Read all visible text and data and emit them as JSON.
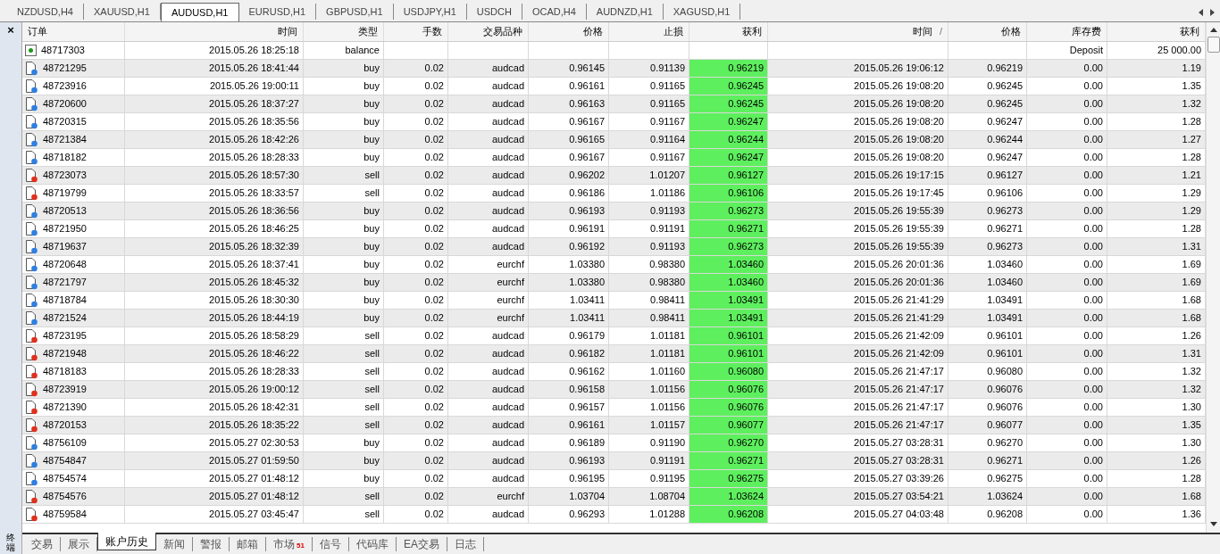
{
  "chart_tabs": [
    {
      "label": "NZDUSD,H4",
      "selected": false
    },
    {
      "label": "XAUUSD,H1",
      "selected": false
    },
    {
      "label": "AUDUSD,H1",
      "selected": true
    },
    {
      "label": "EURUSD,H1",
      "selected": false
    },
    {
      "label": "GBPUSD,H1",
      "selected": false
    },
    {
      "label": "USDJPY,H1",
      "selected": false
    },
    {
      "label": "USDCH",
      "selected": false
    },
    {
      "label": "OCAD,H4",
      "selected": false
    },
    {
      "label": "AUDNZD,H1",
      "selected": false
    },
    {
      "label": "XAGUSD,H1",
      "selected": false
    }
  ],
  "panel": {
    "close": "×",
    "title": "终端"
  },
  "table": {
    "columns": [
      {
        "label": "订单"
      },
      {
        "label": "时间"
      },
      {
        "label": "类型"
      },
      {
        "label": "手数"
      },
      {
        "label": "交易品种"
      },
      {
        "label": "价格"
      },
      {
        "label": "止损"
      },
      {
        "label": "获利"
      },
      {
        "label": "时间",
        "sort_mark": "/"
      },
      {
        "label": "价格"
      },
      {
        "label": "库存费"
      },
      {
        "label": "获利"
      }
    ],
    "rows": [
      {
        "kind": "balance",
        "order": "48717303",
        "open_time": "2015.05.26 18:25:18",
        "type": "balance",
        "swap": "Deposit",
        "profit": "25 000.00"
      },
      {
        "kind": "buy",
        "order": "48721295",
        "open_time": "2015.05.26 18:41:44",
        "type": "buy",
        "lots": "0.02",
        "symbol": "audcad",
        "open_price": "0.96145",
        "sl": "0.91139",
        "tp": "0.96219",
        "close_time": "2015.05.26 19:06:12",
        "close_price": "0.96219",
        "swap": "0.00",
        "profit": "1.19"
      },
      {
        "kind": "buy",
        "order": "48723916",
        "open_time": "2015.05.26 19:00:11",
        "type": "buy",
        "lots": "0.02",
        "symbol": "audcad",
        "open_price": "0.96161",
        "sl": "0.91165",
        "tp": "0.96245",
        "close_time": "2015.05.26 19:08:20",
        "close_price": "0.96245",
        "swap": "0.00",
        "profit": "1.35"
      },
      {
        "kind": "buy",
        "order": "48720600",
        "open_time": "2015.05.26 18:37:27",
        "type": "buy",
        "lots": "0.02",
        "symbol": "audcad",
        "open_price": "0.96163",
        "sl": "0.91165",
        "tp": "0.96245",
        "close_time": "2015.05.26 19:08:20",
        "close_price": "0.96245",
        "swap": "0.00",
        "profit": "1.32"
      },
      {
        "kind": "buy",
        "order": "48720315",
        "open_time": "2015.05.26 18:35:56",
        "type": "buy",
        "lots": "0.02",
        "symbol": "audcad",
        "open_price": "0.96167",
        "sl": "0.91167",
        "tp": "0.96247",
        "close_time": "2015.05.26 19:08:20",
        "close_price": "0.96247",
        "swap": "0.00",
        "profit": "1.28"
      },
      {
        "kind": "buy",
        "order": "48721384",
        "open_time": "2015.05.26 18:42:26",
        "type": "buy",
        "lots": "0.02",
        "symbol": "audcad",
        "open_price": "0.96165",
        "sl": "0.91164",
        "tp": "0.96244",
        "close_time": "2015.05.26 19:08:20",
        "close_price": "0.96244",
        "swap": "0.00",
        "profit": "1.27"
      },
      {
        "kind": "buy",
        "order": "48718182",
        "open_time": "2015.05.26 18:28:33",
        "type": "buy",
        "lots": "0.02",
        "symbol": "audcad",
        "open_price": "0.96167",
        "sl": "0.91167",
        "tp": "0.96247",
        "close_time": "2015.05.26 19:08:20",
        "close_price": "0.96247",
        "swap": "0.00",
        "profit": "1.28"
      },
      {
        "kind": "sell",
        "order": "48723073",
        "open_time": "2015.05.26 18:57:30",
        "type": "sell",
        "lots": "0.02",
        "symbol": "audcad",
        "open_price": "0.96202",
        "sl": "1.01207",
        "tp": "0.96127",
        "close_time": "2015.05.26 19:17:15",
        "close_price": "0.96127",
        "swap": "0.00",
        "profit": "1.21"
      },
      {
        "kind": "sell",
        "order": "48719799",
        "open_time": "2015.05.26 18:33:57",
        "type": "sell",
        "lots": "0.02",
        "symbol": "audcad",
        "open_price": "0.96186",
        "sl": "1.01186",
        "tp": "0.96106",
        "close_time": "2015.05.26 19:17:45",
        "close_price": "0.96106",
        "swap": "0.00",
        "profit": "1.29"
      },
      {
        "kind": "buy",
        "order": "48720513",
        "open_time": "2015.05.26 18:36:56",
        "type": "buy",
        "lots": "0.02",
        "symbol": "audcad",
        "open_price": "0.96193",
        "sl": "0.91193",
        "tp": "0.96273",
        "close_time": "2015.05.26 19:55:39",
        "close_price": "0.96273",
        "swap": "0.00",
        "profit": "1.29"
      },
      {
        "kind": "buy",
        "order": "48721950",
        "open_time": "2015.05.26 18:46:25",
        "type": "buy",
        "lots": "0.02",
        "symbol": "audcad",
        "open_price": "0.96191",
        "sl": "0.91191",
        "tp": "0.96271",
        "close_time": "2015.05.26 19:55:39",
        "close_price": "0.96271",
        "swap": "0.00",
        "profit": "1.28"
      },
      {
        "kind": "buy",
        "order": "48719637",
        "open_time": "2015.05.26 18:32:39",
        "type": "buy",
        "lots": "0.02",
        "symbol": "audcad",
        "open_price": "0.96192",
        "sl": "0.91193",
        "tp": "0.96273",
        "close_time": "2015.05.26 19:55:39",
        "close_price": "0.96273",
        "swap": "0.00",
        "profit": "1.31"
      },
      {
        "kind": "buy",
        "order": "48720648",
        "open_time": "2015.05.26 18:37:41",
        "type": "buy",
        "lots": "0.02",
        "symbol": "eurchf",
        "open_price": "1.03380",
        "sl": "0.98380",
        "tp": "1.03460",
        "close_time": "2015.05.26 20:01:36",
        "close_price": "1.03460",
        "swap": "0.00",
        "profit": "1.69"
      },
      {
        "kind": "buy",
        "order": "48721797",
        "open_time": "2015.05.26 18:45:32",
        "type": "buy",
        "lots": "0.02",
        "symbol": "eurchf",
        "open_price": "1.03380",
        "sl": "0.98380",
        "tp": "1.03460",
        "close_time": "2015.05.26 20:01:36",
        "close_price": "1.03460",
        "swap": "0.00",
        "profit": "1.69"
      },
      {
        "kind": "buy",
        "order": "48718784",
        "open_time": "2015.05.26 18:30:30",
        "type": "buy",
        "lots": "0.02",
        "symbol": "eurchf",
        "open_price": "1.03411",
        "sl": "0.98411",
        "tp": "1.03491",
        "close_time": "2015.05.26 21:41:29",
        "close_price": "1.03491",
        "swap": "0.00",
        "profit": "1.68"
      },
      {
        "kind": "buy",
        "order": "48721524",
        "open_time": "2015.05.26 18:44:19",
        "type": "buy",
        "lots": "0.02",
        "symbol": "eurchf",
        "open_price": "1.03411",
        "sl": "0.98411",
        "tp": "1.03491",
        "close_time": "2015.05.26 21:41:29",
        "close_price": "1.03491",
        "swap": "0.00",
        "profit": "1.68"
      },
      {
        "kind": "sell",
        "order": "48723195",
        "open_time": "2015.05.26 18:58:29",
        "type": "sell",
        "lots": "0.02",
        "symbol": "audcad",
        "open_price": "0.96179",
        "sl": "1.01181",
        "tp": "0.96101",
        "close_time": "2015.05.26 21:42:09",
        "close_price": "0.96101",
        "swap": "0.00",
        "profit": "1.26"
      },
      {
        "kind": "sell",
        "order": "48721948",
        "open_time": "2015.05.26 18:46:22",
        "type": "sell",
        "lots": "0.02",
        "symbol": "audcad",
        "open_price": "0.96182",
        "sl": "1.01181",
        "tp": "0.96101",
        "close_time": "2015.05.26 21:42:09",
        "close_price": "0.96101",
        "swap": "0.00",
        "profit": "1.31"
      },
      {
        "kind": "sell",
        "order": "48718183",
        "open_time": "2015.05.26 18:28:33",
        "type": "sell",
        "lots": "0.02",
        "symbol": "audcad",
        "open_price": "0.96162",
        "sl": "1.01160",
        "tp": "0.96080",
        "close_time": "2015.05.26 21:47:17",
        "close_price": "0.96080",
        "swap": "0.00",
        "profit": "1.32"
      },
      {
        "kind": "sell",
        "order": "48723919",
        "open_time": "2015.05.26 19:00:12",
        "type": "sell",
        "lots": "0.02",
        "symbol": "audcad",
        "open_price": "0.96158",
        "sl": "1.01156",
        "tp": "0.96076",
        "close_time": "2015.05.26 21:47:17",
        "close_price": "0.96076",
        "swap": "0.00",
        "profit": "1.32"
      },
      {
        "kind": "sell",
        "order": "48721390",
        "open_time": "2015.05.26 18:42:31",
        "type": "sell",
        "lots": "0.02",
        "symbol": "audcad",
        "open_price": "0.96157",
        "sl": "1.01156",
        "tp": "0.96076",
        "close_time": "2015.05.26 21:47:17",
        "close_price": "0.96076",
        "swap": "0.00",
        "profit": "1.30"
      },
      {
        "kind": "sell",
        "order": "48720153",
        "open_time": "2015.05.26 18:35:22",
        "type": "sell",
        "lots": "0.02",
        "symbol": "audcad",
        "open_price": "0.96161",
        "sl": "1.01157",
        "tp": "0.96077",
        "close_time": "2015.05.26 21:47:17",
        "close_price": "0.96077",
        "swap": "0.00",
        "profit": "1.35"
      },
      {
        "kind": "buy",
        "order": "48756109",
        "open_time": "2015.05.27 02:30:53",
        "type": "buy",
        "lots": "0.02",
        "symbol": "audcad",
        "open_price": "0.96189",
        "sl": "0.91190",
        "tp": "0.96270",
        "close_time": "2015.05.27 03:28:31",
        "close_price": "0.96270",
        "swap": "0.00",
        "profit": "1.30"
      },
      {
        "kind": "buy",
        "order": "48754847",
        "open_time": "2015.05.27 01:59:50",
        "type": "buy",
        "lots": "0.02",
        "symbol": "audcad",
        "open_price": "0.96193",
        "sl": "0.91191",
        "tp": "0.96271",
        "close_time": "2015.05.27 03:28:31",
        "close_price": "0.96271",
        "swap": "0.00",
        "profit": "1.26"
      },
      {
        "kind": "buy",
        "order": "48754574",
        "open_time": "2015.05.27 01:48:12",
        "type": "buy",
        "lots": "0.02",
        "symbol": "audcad",
        "open_price": "0.96195",
        "sl": "0.91195",
        "tp": "0.96275",
        "close_time": "2015.05.27 03:39:26",
        "close_price": "0.96275",
        "swap": "0.00",
        "profit": "1.28"
      },
      {
        "kind": "sell",
        "order": "48754576",
        "open_time": "2015.05.27 01:48:12",
        "type": "sell",
        "lots": "0.02",
        "symbol": "eurchf",
        "open_price": "1.03704",
        "sl": "1.08704",
        "tp": "1.03624",
        "close_time": "2015.05.27 03:54:21",
        "close_price": "1.03624",
        "swap": "0.00",
        "profit": "1.68"
      },
      {
        "kind": "sell",
        "order": "48759584",
        "open_time": "2015.05.27 03:45:47",
        "type": "sell",
        "lots": "0.02",
        "symbol": "audcad",
        "open_price": "0.96293",
        "sl": "1.01288",
        "tp": "0.96208",
        "close_time": "2015.05.27 04:03:48",
        "close_price": "0.96208",
        "swap": "0.00",
        "profit": "1.36"
      }
    ]
  },
  "bottom_tabs": [
    {
      "label": "交易",
      "selected": false
    },
    {
      "label": "展示",
      "selected": false
    },
    {
      "label": "账户历史",
      "selected": true
    },
    {
      "label": "新闻",
      "selected": false
    },
    {
      "label": "警报",
      "selected": false
    },
    {
      "label": "邮箱",
      "selected": false
    },
    {
      "label": "市场",
      "selected": false,
      "badge": "51"
    },
    {
      "label": "信号",
      "selected": false
    },
    {
      "label": "代码库",
      "selected": false
    },
    {
      "label": "EA交易",
      "selected": false
    },
    {
      "label": "日志",
      "selected": false
    }
  ]
}
